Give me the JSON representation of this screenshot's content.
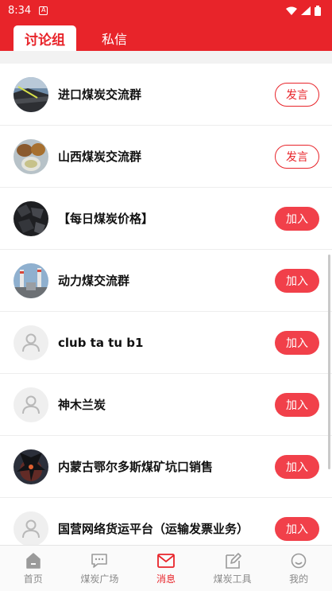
{
  "status_bar": {
    "time": "8:34",
    "notif_glyph": "A"
  },
  "tabs": [
    {
      "label": "讨论组",
      "active": true
    },
    {
      "label": "私信",
      "active": false
    }
  ],
  "groups": [
    {
      "name": "进口煤炭交流群",
      "action": "发言",
      "style": "outline",
      "avatar": "photo-coal-yard"
    },
    {
      "name": "山西煤炭交流群",
      "action": "发言",
      "style": "outline",
      "avatar": "photo-food-bowls"
    },
    {
      "name": "【每日煤炭价格】",
      "action": "加入",
      "style": "filled",
      "avatar": "photo-coal-lumps"
    },
    {
      "name": "动力煤交流群",
      "action": "加入",
      "style": "filled",
      "avatar": "photo-power-plant"
    },
    {
      "name": "club ta tu b1",
      "action": "加入",
      "style": "filled",
      "avatar": "default-user-icon"
    },
    {
      "name": "神木兰炭",
      "action": "加入",
      "style": "filled",
      "avatar": "default-user-icon"
    },
    {
      "name": "内蒙古鄂尔多斯煤矿坑口销售",
      "action": "加入",
      "style": "filled",
      "avatar": "photo-dragon"
    },
    {
      "name": "国营网络货运平台（运输发票业务）",
      "action": "加入",
      "style": "filled",
      "avatar": "default-user-icon"
    }
  ],
  "bottom_nav": [
    {
      "label": "首页",
      "icon": "home-icon",
      "active": false
    },
    {
      "label": "煤炭广场",
      "icon": "chat-bubble-icon",
      "active": false
    },
    {
      "label": "消息",
      "icon": "mail-icon",
      "active": true
    },
    {
      "label": "煤炭工具",
      "icon": "edit-icon",
      "active": false
    },
    {
      "label": "我的",
      "icon": "profile-icon",
      "active": false
    }
  ],
  "colors": {
    "brand": "#e8242a",
    "button_filled": "#f1404a"
  }
}
